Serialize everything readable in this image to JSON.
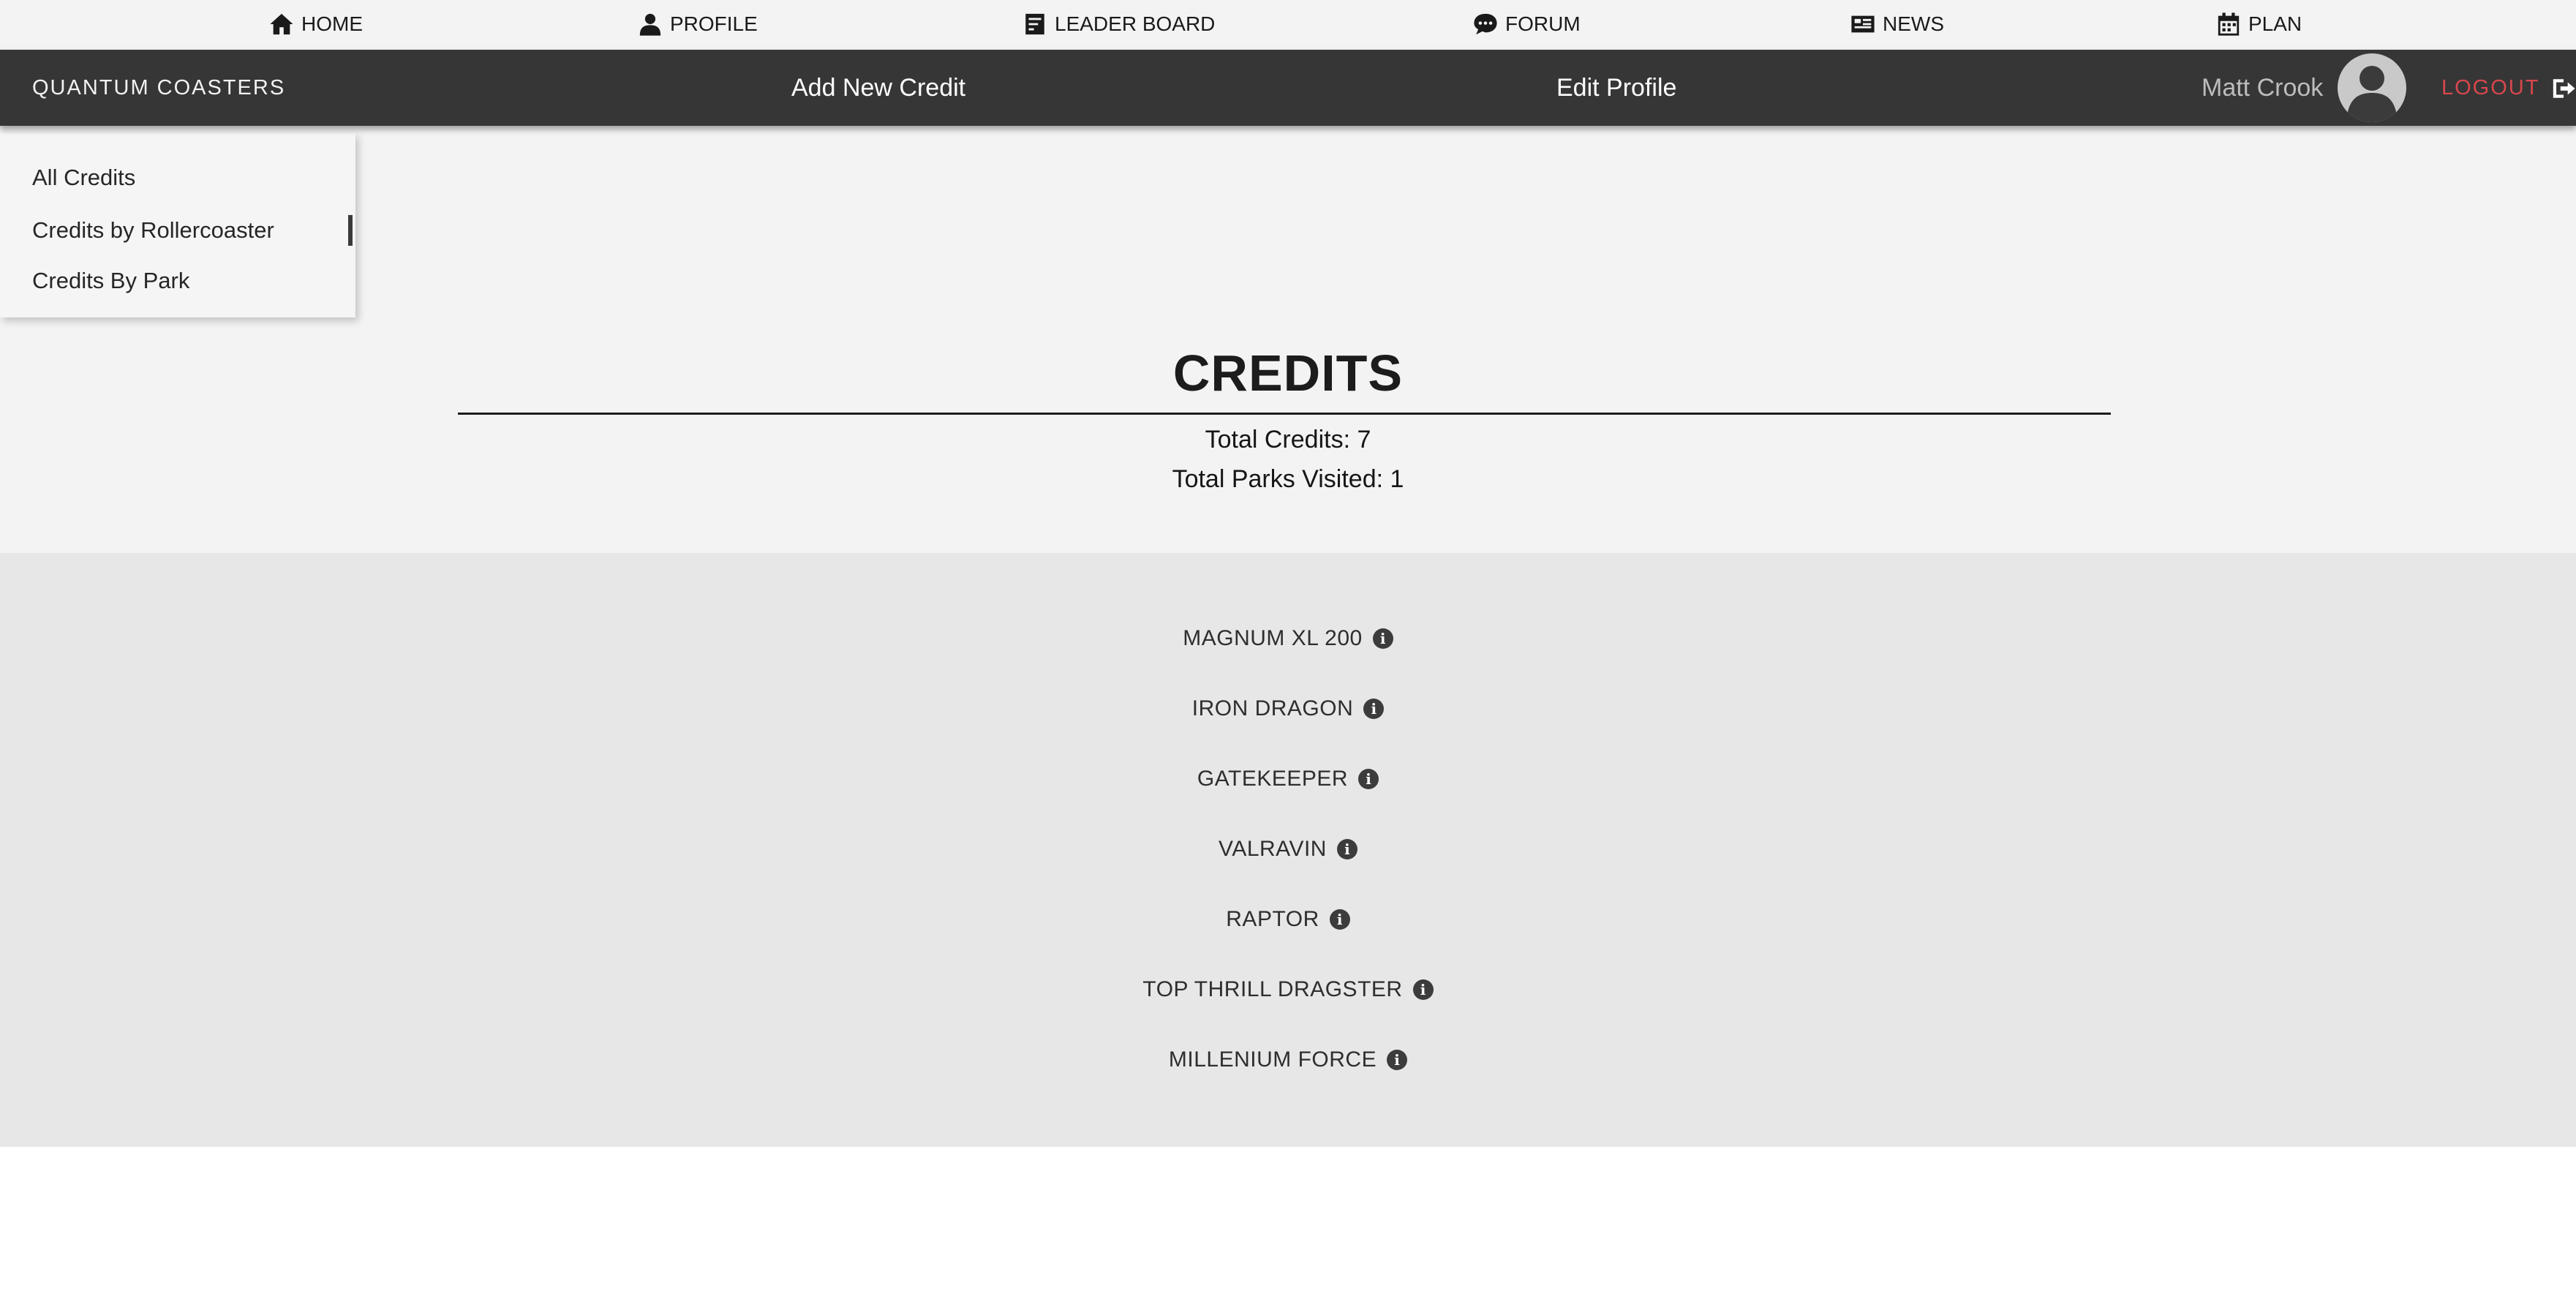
{
  "top_nav": {
    "items": [
      {
        "label": "HOME",
        "icon": "home-icon"
      },
      {
        "label": "PROFILE",
        "icon": "user-icon"
      },
      {
        "label": "LEADER BOARD",
        "icon": "leaderboard-icon"
      },
      {
        "label": "FORUM",
        "icon": "chat-icon"
      },
      {
        "label": "NEWS",
        "icon": "newspaper-icon"
      },
      {
        "label": "PLAN",
        "icon": "calendar-icon"
      }
    ]
  },
  "header": {
    "brand": "QUANTUM COASTERS",
    "add_credit_label": "Add New Credit",
    "edit_profile_label": "Edit Profile",
    "username": "Matt Crook",
    "logout_label": "LOGOUT"
  },
  "side_menu": {
    "items": [
      {
        "label": "All Credits",
        "active": false
      },
      {
        "label": "Credits by Rollercoaster",
        "active": true
      },
      {
        "label": "Credits By Park",
        "active": false
      }
    ]
  },
  "main": {
    "title": "CREDITS",
    "total_credits_label": "Total Credits: 7",
    "total_parks_label": "Total Parks Visited: 1"
  },
  "credits": [
    {
      "name": "MAGNUM XL 200",
      "icon": "info-icon"
    },
    {
      "name": "IRON DRAGON",
      "icon": "info-icon"
    },
    {
      "name": "GATEKEEPER",
      "icon": "info-icon"
    },
    {
      "name": "VALRAVIN",
      "icon": "info-icon"
    },
    {
      "name": "RAPTOR",
      "icon": "info-icon"
    },
    {
      "name": "TOP THRILL DRAGSTER",
      "icon": "info-icon"
    },
    {
      "name": "MILLENIUM FORCE",
      "icon": "info-icon"
    }
  ],
  "colors": {
    "header_bg": "#363636",
    "logout": "#d8474d",
    "light_bg": "#f3f3f3",
    "list_bg": "#e7e7e7"
  }
}
